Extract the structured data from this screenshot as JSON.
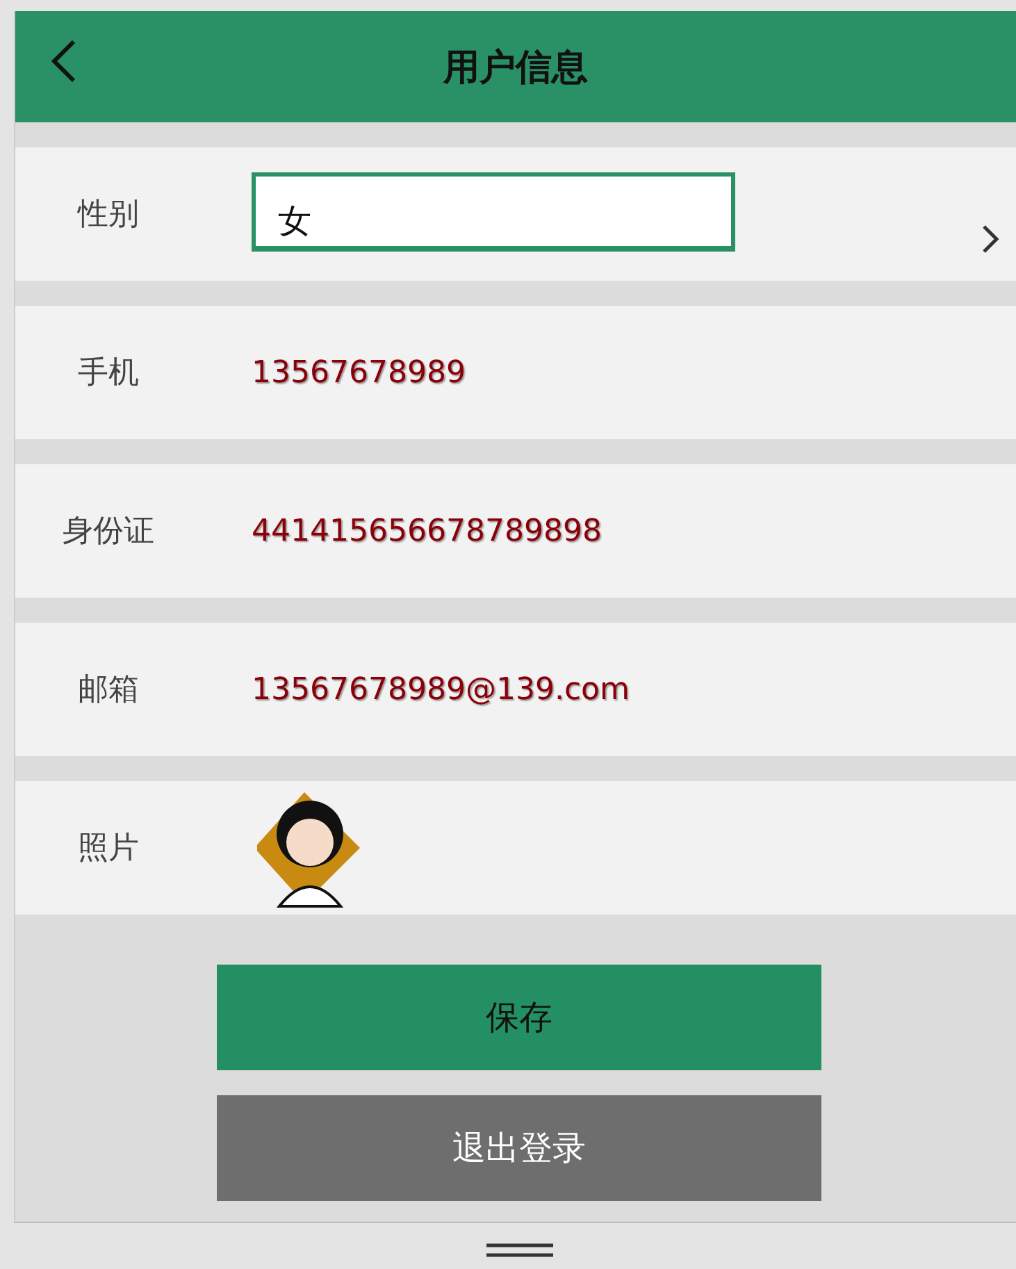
{
  "header": {
    "title": "用户信息"
  },
  "fields": [
    {
      "kind": "select",
      "label": "性别",
      "value": "女"
    },
    {
      "kind": "text",
      "label": "手机",
      "value": "13567678989"
    },
    {
      "kind": "text",
      "label": "身份证",
      "value": "441415656678789898"
    },
    {
      "kind": "text",
      "label": "邮箱",
      "value": "13567678989@139.com"
    },
    {
      "kind": "photo",
      "label": "照片"
    }
  ],
  "buttons": [
    {
      "kind": "primary",
      "label": "保存"
    },
    {
      "kind": "secondary",
      "label": "退出登录"
    }
  ]
}
